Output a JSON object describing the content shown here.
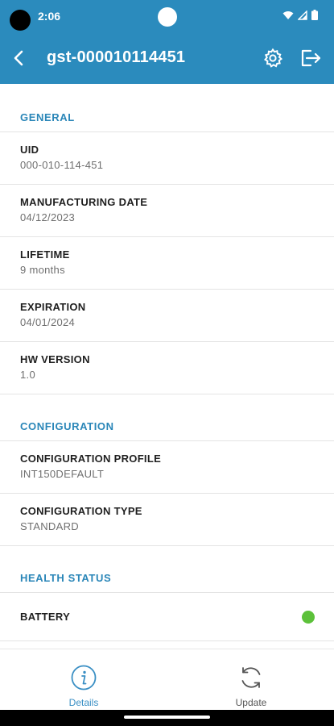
{
  "status_bar": {
    "time": "2:06"
  },
  "app_bar": {
    "title": "gst-000010114451"
  },
  "sections": [
    {
      "title": "GENERAL",
      "rows": [
        {
          "label": "UID",
          "value": "000-010-114-451"
        },
        {
          "label": "MANUFACTURING DATE",
          "value": "04/12/2023"
        },
        {
          "label": "LIFETIME",
          "value": "9 months"
        },
        {
          "label": "EXPIRATION",
          "value": "04/01/2024"
        },
        {
          "label": "HW VERSION",
          "value": "1.0"
        }
      ]
    },
    {
      "title": "CONFIGURATION",
      "rows": [
        {
          "label": "CONFIGURATION PROFILE",
          "value": "INT150DEFAULT"
        },
        {
          "label": "CONFIGURATION TYPE",
          "value": "STANDARD"
        }
      ]
    },
    {
      "title": "HEALTH STATUS",
      "rows": [
        {
          "label": "BATTERY",
          "status_color": "#5cc13a"
        }
      ]
    }
  ],
  "bottom_nav": {
    "details_label": "Details",
    "update_label": "Update"
  },
  "colors": {
    "accent": "#2b8bbd",
    "section_title": "#2a86b8",
    "active_nav": "#3a8fc4",
    "inactive_nav": "#555555",
    "battery_ok": "#5cc13a"
  },
  "icons": {
    "back": "chevron-left-icon",
    "settings": "gear-icon",
    "logout": "exit-icon",
    "details": "info-circle-icon",
    "update": "refresh-icon"
  }
}
